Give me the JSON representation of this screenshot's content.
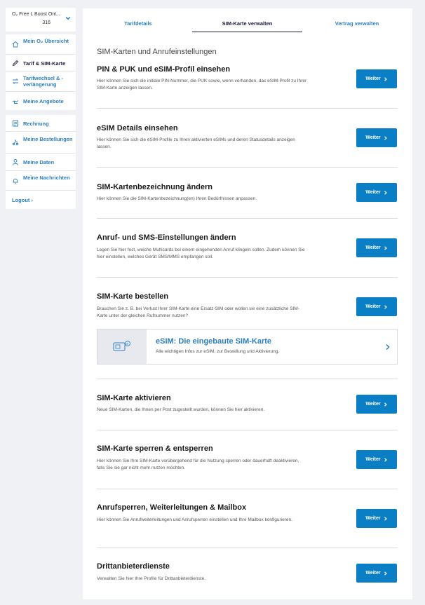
{
  "sidebar": {
    "tariff_line1": "O₂ Free L Boost Onl...",
    "tariff_line2": "316",
    "group1": [
      {
        "label": "Mein O₂ Übersicht",
        "icon": "house-icon"
      },
      {
        "label": "Tarif & SIM-Karte",
        "icon": "pen-icon"
      },
      {
        "label": "Tarifwechsel & -verlängerung",
        "icon": "swap-icon"
      },
      {
        "label": "Meine Angebote",
        "icon": "hand-icon"
      }
    ],
    "group2": [
      {
        "label": "Rechnung",
        "icon": "invoice-icon"
      },
      {
        "label": "Meine Bestellungen",
        "icon": "scooter-icon"
      },
      {
        "label": "Meine Daten",
        "icon": "user-icon"
      },
      {
        "label": "Meine Nachrichten",
        "icon": "bell-icon"
      }
    ],
    "logout": "Logout ›"
  },
  "tabs": [
    "Tarifdetails",
    "SIM-Karte verwalten",
    "Vertrag verwalten"
  ],
  "section_title": "SIM-Karten und Anrufeinstellungen",
  "button_label": "Weiter",
  "rows": [
    {
      "title": "PIN & PUK und eSIM-Profil einsehen",
      "desc": "Hier können Sie sich die initiale PIN-Nummer, die PUK sowie, wenn vorhanden, das eSIM-Profil zu Ihrer SIM-Karte anzeigen lassen."
    },
    {
      "title": "eSIM Details einsehen",
      "desc": "Hier können Sie sich die eSIM-Profile zu Ihren aktivierten eSIMs und deren Statusdetails anzeigen lassen."
    },
    {
      "title": "SIM-Kartenbezeichnung ändern",
      "desc": "Hier können Sie die SIM-Kartenbezeichnung(en) Ihren Bedürfnissen anpassen."
    },
    {
      "title": "Anruf- und SMS-Einstellungen ändern",
      "desc": "Legen Sie hier fest, welche Multicards bei einem eingehenden Anruf klingeln sollen. Zudem können Sie hier einstellen, welches Gerät SMS/MMS empfangen soll."
    },
    {
      "title": "SIM-Karte bestellen",
      "desc": "Brauchen Sie z. B. bei Verlust Ihrer SIM-Karte eine Ersatz-SIM oder wollen sie eine zusätzliche SIM-Karte unter der gleichen Rufnummer nutzen?"
    },
    {
      "title": "SIM-Karte aktivieren",
      "desc": "Neue SIM-Karten, die Ihnen per Post zugestellt wurden, können Sie hier aktivieren."
    },
    {
      "title": "SIM-Karte sperren & entsperren",
      "desc": "Hier können Sie Ihre SIM-Karte vorübergehend für die Nutzung sperren oder dauerhaft deaktivieren, falls Sie sie gar nicht mehr nutzen möchten."
    },
    {
      "title": "Anrufsperren, Weiterleitungen & Mailbox",
      "desc": "Hier können Sie Anrufweiterleitungen und Anrufsperren einstellen und Ihre Mailbox konfigurieren."
    },
    {
      "title": "Drittanbieterdienste",
      "desc": "Verwalten Sie hier Ihre Profile für Drittanbieterdienste."
    }
  ],
  "esim_card": {
    "title": "eSIM: Die eingebaute SIM-Karte",
    "desc": "Alle wichtigen Infos zur eSIM, zur Bestellung und Aktivierung."
  },
  "colors": {
    "accent": "#0a7fc5",
    "link": "#2a7fc1",
    "background": "#f0f1f5"
  }
}
